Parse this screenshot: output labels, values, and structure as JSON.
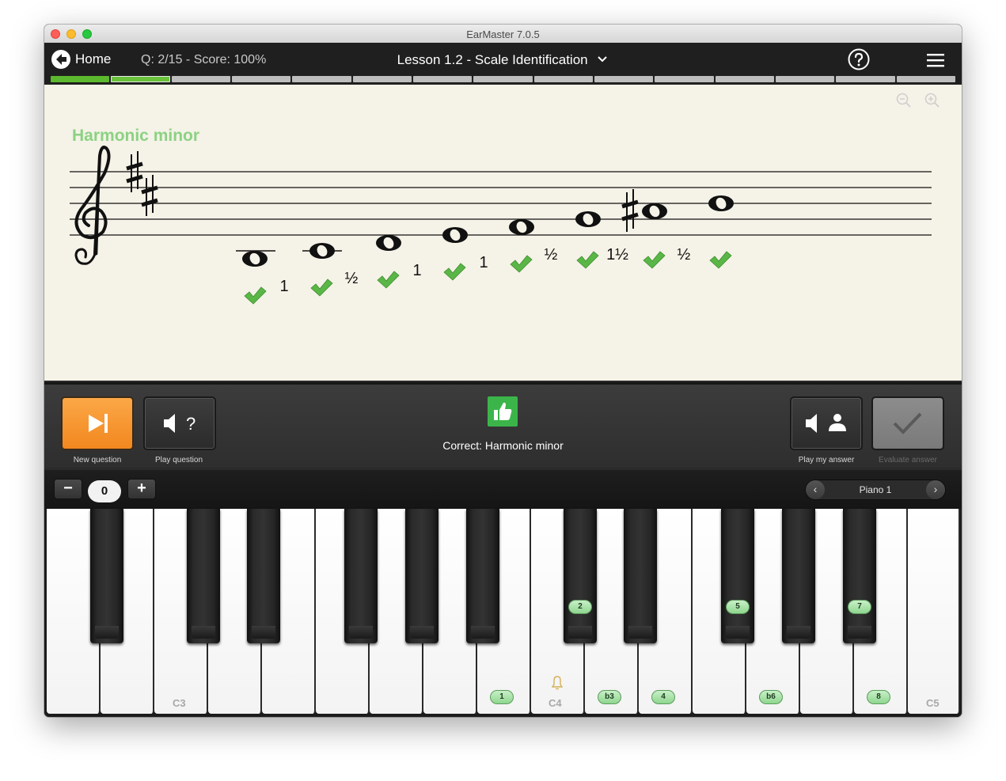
{
  "window": {
    "title": "EarMaster 7.0.5"
  },
  "header": {
    "home_label": "Home",
    "question_score": "Q: 2/15 - Score: 100%",
    "lesson_title": "Lesson 1.2 - Scale Identification",
    "progress": {
      "total_segments": 15,
      "completed": 1,
      "current": 2
    }
  },
  "score": {
    "scale_name": "Harmonic minor",
    "clef": "treble",
    "key_signature": [
      "F♯",
      "C♯"
    ],
    "intervals": [
      "1",
      "½",
      "1",
      "1",
      "½",
      "1½",
      "½"
    ],
    "marks": [
      "check",
      "check",
      "check",
      "check",
      "check",
      "check",
      "check",
      "check"
    ],
    "accidental": "♯"
  },
  "controls": {
    "new_question_label": "New question",
    "play_question_label": "Play question",
    "play_question_glyph": "?",
    "correct_text": "Correct: Harmonic minor",
    "play_answer_label": "Play my answer",
    "evaluate_label": "Evaluate answer"
  },
  "keyboard": {
    "octave_minus": "−",
    "octave_value": "0",
    "octave_plus": "+",
    "instrument": "Piano 1",
    "prev_arrow": "‹",
    "next_arrow": "›",
    "octave_labels": [
      "C3",
      "C4",
      "C5"
    ],
    "degrees": {
      "white": [
        "1",
        "b3",
        "4",
        "b6",
        "8"
      ],
      "black": [
        "2",
        "5",
        "7"
      ]
    }
  },
  "colors": {
    "accent_green": "#5cb82e",
    "scale_name_green": "#8bd283",
    "check_green": "#5ab646",
    "orange_button": "#f2871f",
    "thumbs_green": "#3bb54a"
  }
}
